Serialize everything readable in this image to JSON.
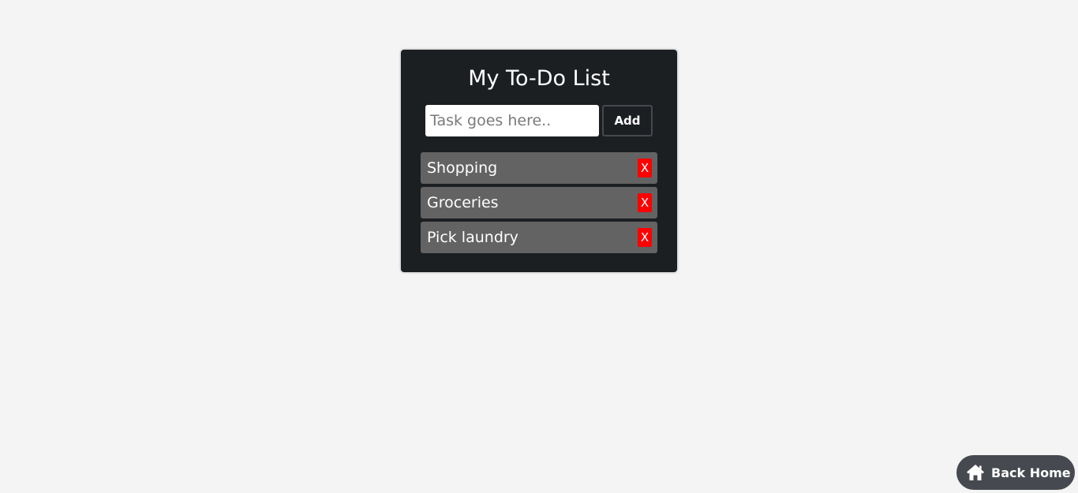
{
  "card": {
    "title": "My To-Do List",
    "input": {
      "placeholder": "Task goes here..",
      "value": ""
    },
    "add_label": "Add",
    "tasks": [
      {
        "label": "Shopping",
        "delete_label": "X"
      },
      {
        "label": "Groceries",
        "delete_label": "X"
      },
      {
        "label": "Pick laundry",
        "delete_label": "X"
      }
    ]
  },
  "back_home": {
    "label": "Back Home",
    "icon": "home-icon"
  },
  "colors": {
    "page_background": "#f4f4f4",
    "card_background": "#1c1f22",
    "task_background": "#636363",
    "delete_background": "#ff0000",
    "back_home_background": "#464a50"
  }
}
